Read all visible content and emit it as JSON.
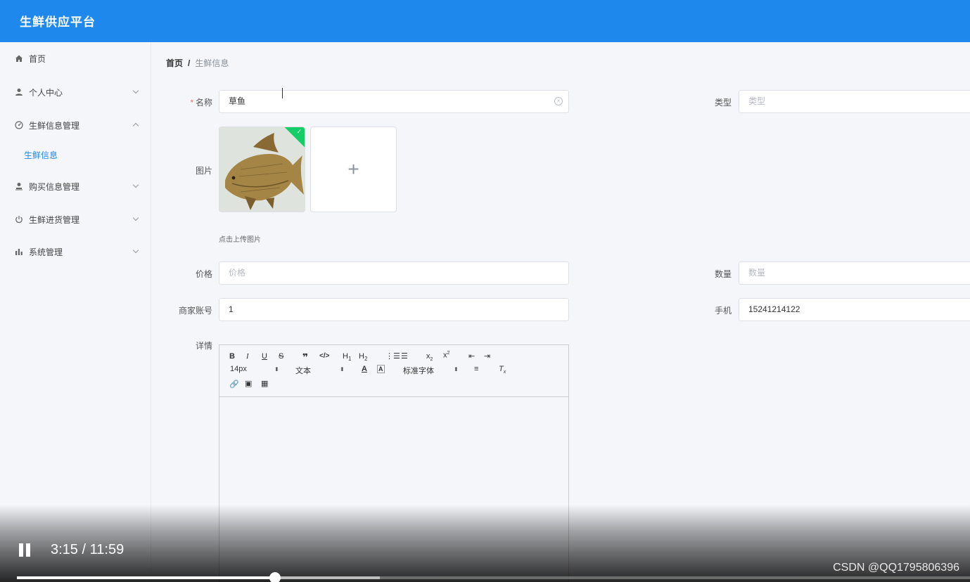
{
  "app": {
    "title": "生鲜供应平台"
  },
  "sidebar": {
    "items": [
      {
        "label": "首页"
      },
      {
        "label": "个人中心"
      },
      {
        "label": "生鲜信息管理",
        "sub": [
          {
            "label": "生鲜信息"
          }
        ]
      },
      {
        "label": "购买信息管理"
      },
      {
        "label": "生鲜进货管理"
      },
      {
        "label": "系统管理"
      }
    ]
  },
  "breadcrumb": {
    "home": "首页",
    "separator": "/",
    "current": "生鲜信息"
  },
  "form": {
    "name": {
      "label": "名称",
      "value": "草鱼"
    },
    "type": {
      "label": "类型",
      "placeholder": "类型"
    },
    "image": {
      "label": "图片",
      "upload_tip": "点击上传图片",
      "plus": "+"
    },
    "price": {
      "label": "价格",
      "placeholder": "价格"
    },
    "quantity": {
      "label": "数量",
      "placeholder": "数量"
    },
    "merchant_account": {
      "label": "商家账号",
      "value": "1"
    },
    "phone": {
      "label": "手机",
      "value": "15241214122"
    },
    "details": {
      "label": "详情"
    }
  },
  "editor": {
    "font_size": "14px",
    "header_select": "文本",
    "font_family": "标准字体"
  },
  "video": {
    "current_time": "3:15",
    "duration": "11:59",
    "separator": "/",
    "played_fraction": 0.271,
    "buffered_fraction": 0.381
  },
  "watermark": "CSDN @QQ1795806396",
  "colors": {
    "primary": "#1e88ec",
    "success": "#13ce66",
    "required": "#f56c6c"
  }
}
